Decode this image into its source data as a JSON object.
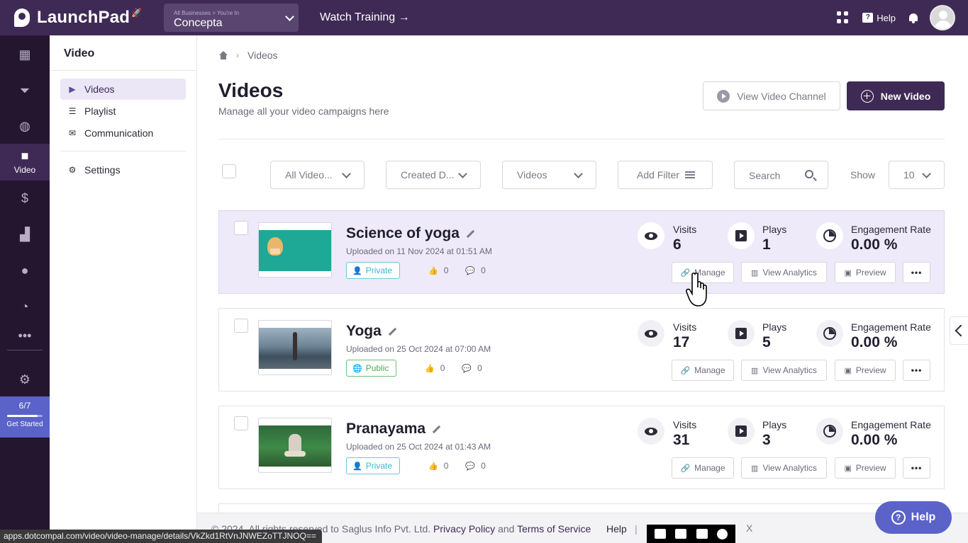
{
  "topbar": {
    "brand": "LaunchPad",
    "business_breadcrumb": "All Businesses > You're In",
    "business_name": "Concepta",
    "watch_training": "Watch Training →",
    "help_label": "Help"
  },
  "rail": {
    "active_label": "Video",
    "get_started_count": "6/7",
    "get_started_progress": 0.857,
    "get_started_label": "Get Started"
  },
  "subnav": {
    "title": "Video",
    "items": [
      {
        "label": "Videos",
        "icon": "video-icon",
        "active": true
      },
      {
        "label": "Playlist",
        "icon": "playlist-icon",
        "active": false
      },
      {
        "label": "Communication",
        "icon": "chat-icon",
        "active": false
      }
    ],
    "settings_label": "Settings"
  },
  "main": {
    "breadcrumb_current": "Videos",
    "title": "Videos",
    "subtitle": "Manage all your video campaigns here",
    "view_channel_label": "View Video Channel",
    "new_video_label": "New Video",
    "filters": {
      "all_videos": "All Video...",
      "created_date": "Created D...",
      "videos": "Videos",
      "add_filter": "Add Filter",
      "search_placeholder": "Search",
      "show_label": "Show",
      "show_value": "10"
    },
    "videos": [
      {
        "title": "Science of yoga",
        "uploaded": "Uploaded on 11 Nov 2024 at 01:51 AM",
        "visibility": "Private",
        "likes": "0",
        "comments": "0",
        "visits": "6",
        "plays": "1",
        "engagement": "0.00 %"
      },
      {
        "title": "Yoga",
        "uploaded": "Uploaded on 25 Oct 2024 at 07:00 AM",
        "visibility": "Public",
        "likes": "0",
        "comments": "0",
        "visits": "17",
        "plays": "5",
        "engagement": "0.00 %"
      },
      {
        "title": "Pranayama",
        "uploaded": "Uploaded on 25 Oct 2024 at 01:43 AM",
        "visibility": "Private",
        "likes": "0",
        "comments": "0",
        "visits": "31",
        "plays": "3",
        "engagement": "0.00 %"
      }
    ],
    "labels": {
      "visits": "Visits",
      "plays": "Plays",
      "engagement": "Engagement Rate",
      "manage": "Manage",
      "view_analytics": "View Analytics",
      "preview": "Preview",
      "more": "•••"
    }
  },
  "footer": {
    "copyright": "© 2024. All rights reserved to Saglus Info Pvt. Ltd.",
    "privacy": "Privacy Policy",
    "and": "and",
    "terms": "Terms of Service",
    "help": "Help",
    "pipe": "|",
    "x_icon": "X"
  },
  "help_widget": {
    "label": "Help"
  },
  "status_url": "apps.dotcompal.com/video/video-manage/details/VkZkd1RtVnJNWEZoTTJNOQ==",
  "colors": {
    "primary": "#3f2a55",
    "rail": "#24162f",
    "accent": "#5b63c8",
    "hover_row": "#eeeaf9",
    "private": "#3fb6cf",
    "public": "#4caf50"
  }
}
